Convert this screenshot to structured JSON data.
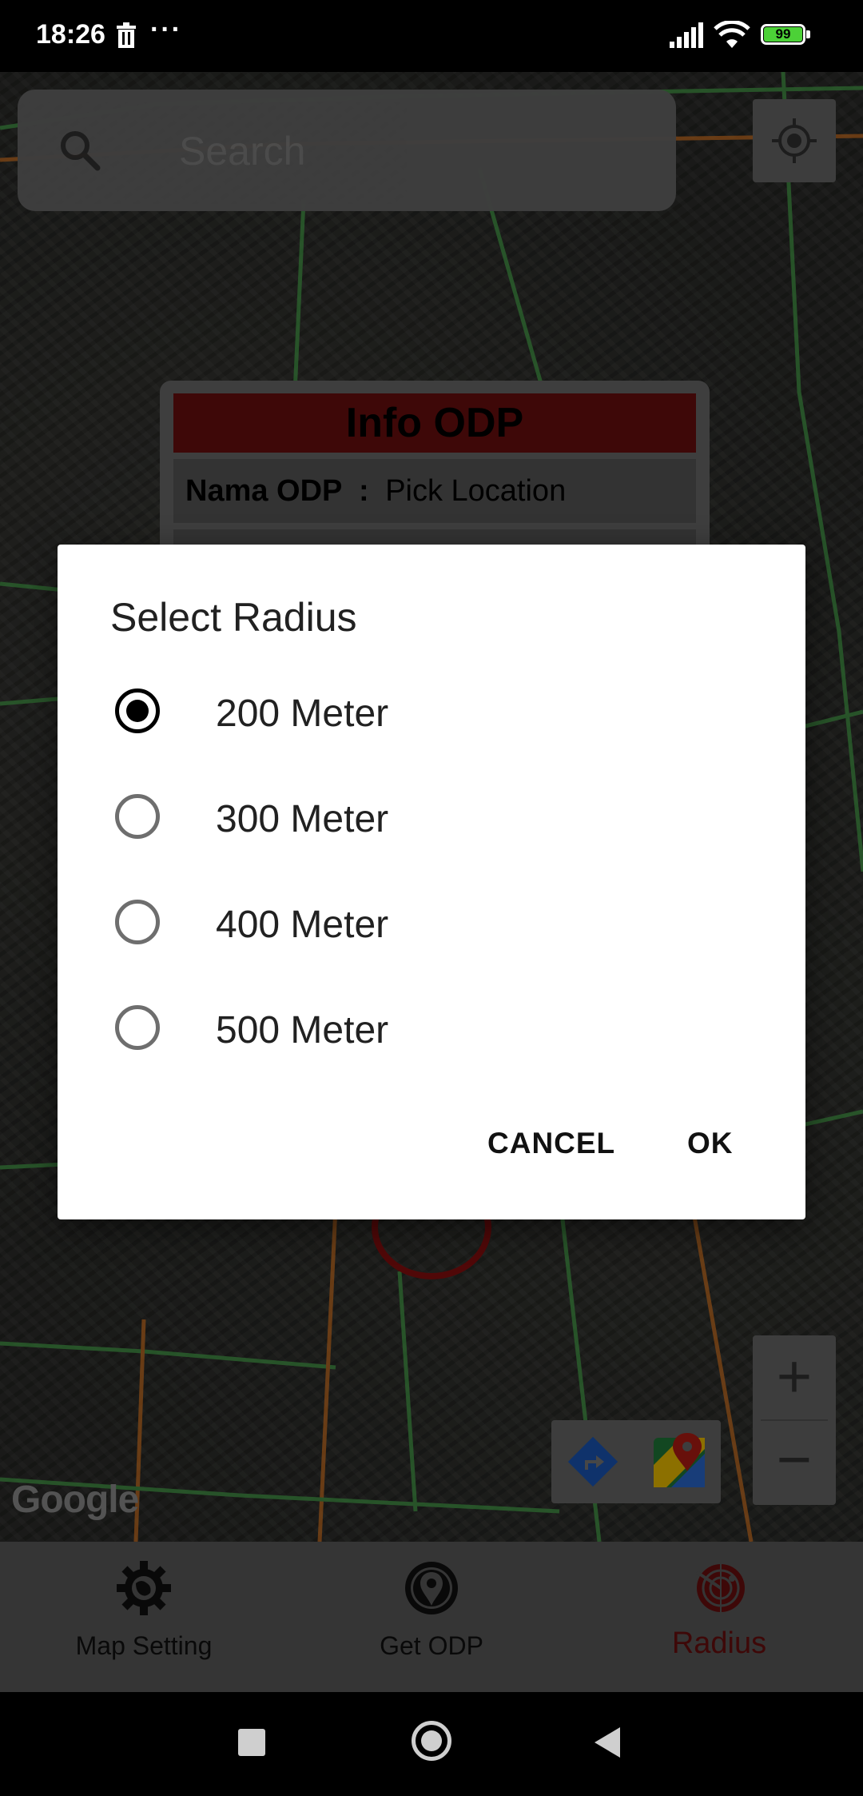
{
  "status_bar": {
    "time": "18:26",
    "dots": "···",
    "battery": "99"
  },
  "search": {
    "placeholder": "Search"
  },
  "info_panel": {
    "title": "Info ODP",
    "nama_key": "Nama ODP",
    "separator": ":",
    "nama_value": "Pick Location"
  },
  "map": {
    "attribution": "Google",
    "zoom_in": "+",
    "zoom_out": "−"
  },
  "dialog": {
    "title": "Select Radius",
    "options": [
      {
        "label": "200 Meter",
        "checked": true
      },
      {
        "label": "300 Meter",
        "checked": false
      },
      {
        "label": "400 Meter",
        "checked": false
      },
      {
        "label": "500 Meter",
        "checked": false
      }
    ],
    "cancel": "CANCEL",
    "ok": "OK"
  },
  "bottom_nav": {
    "items": [
      {
        "label": "Map Setting",
        "icon": "gear-globe-icon",
        "active": false
      },
      {
        "label": "Get ODP",
        "icon": "location-pin-icon",
        "active": false
      },
      {
        "label": "Radius",
        "icon": "radar-icon",
        "active": true
      }
    ]
  },
  "colors": {
    "accent": "#6b0f0f",
    "radio_checked": "#000000",
    "dialog_bg": "#ffffff"
  }
}
